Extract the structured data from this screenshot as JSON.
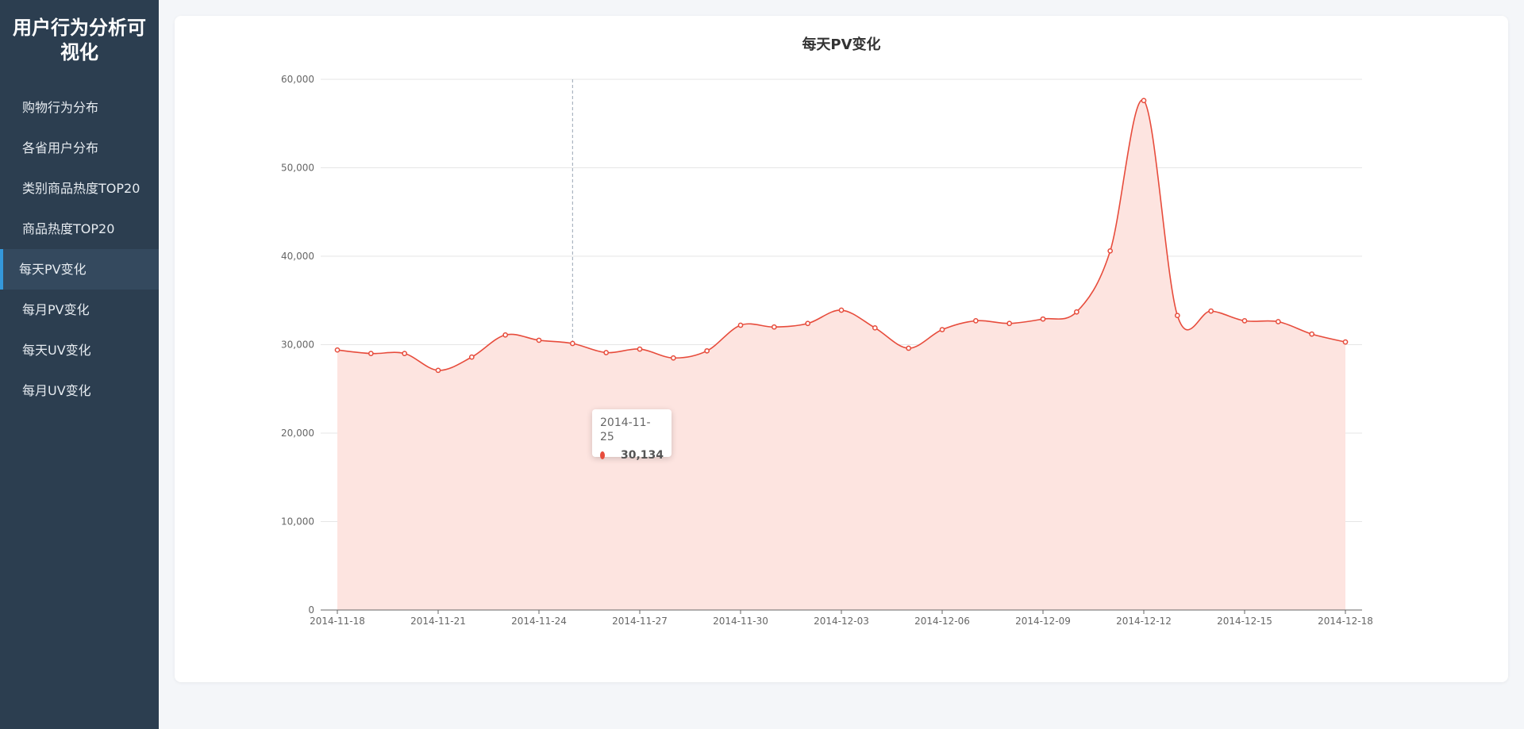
{
  "app": {
    "title": "用户行为分析可视化"
  },
  "sidebar": {
    "items": [
      {
        "label": "购物行为分布",
        "active": false
      },
      {
        "label": "各省用户分布",
        "active": false
      },
      {
        "label": "类别商品热度TOP20",
        "active": false
      },
      {
        "label": "商品热度TOP20",
        "active": false
      },
      {
        "label": "每天PV变化",
        "active": true
      },
      {
        "label": "每月PV变化",
        "active": false
      },
      {
        "label": "每天UV变化",
        "active": false
      },
      {
        "label": "每月UV变化",
        "active": false
      }
    ]
  },
  "colors": {
    "accent": "#e74c3c",
    "area": "#fde4e0",
    "sidebar": "#2c3e50",
    "sidebar_active": "#34495e",
    "active_marker": "#3498db"
  },
  "tooltip": {
    "date": "2014-11-25",
    "value": "30,134"
  },
  "chart_data": {
    "type": "area",
    "title": "每天PV变化",
    "x": [
      "2014-11-18",
      "2014-11-19",
      "2014-11-20",
      "2014-11-21",
      "2014-11-22",
      "2014-11-23",
      "2014-11-24",
      "2014-11-25",
      "2014-11-26",
      "2014-11-27",
      "2014-11-28",
      "2014-11-29",
      "2014-11-30",
      "2014-12-01",
      "2014-12-02",
      "2014-12-03",
      "2014-12-04",
      "2014-12-05",
      "2014-12-06",
      "2014-12-07",
      "2014-12-08",
      "2014-12-09",
      "2014-12-10",
      "2014-12-11",
      "2014-12-12",
      "2014-12-13",
      "2014-12-14",
      "2014-12-15",
      "2014-12-16",
      "2014-12-17",
      "2014-12-18"
    ],
    "series": [
      {
        "values": [
          29400,
          29000,
          29000,
          27100,
          28600,
          31100,
          30500,
          30134,
          29100,
          29500,
          28500,
          29300,
          32200,
          32000,
          32400,
          33900,
          31900,
          29600,
          31700,
          32700,
          32400,
          32900,
          33700,
          40600,
          57600,
          33300,
          33800,
          32700,
          32600,
          31200,
          30300
        ]
      }
    ],
    "xticks": [
      "2014-11-18",
      "2014-11-21",
      "2014-11-24",
      "2014-11-27",
      "2014-11-30",
      "2014-12-03",
      "2014-12-06",
      "2014-12-09",
      "2014-12-12",
      "2014-12-15",
      "2014-12-18"
    ],
    "yticks": [
      "0",
      "10,000",
      "20,000",
      "30,000",
      "40,000",
      "50,000",
      "60,000"
    ],
    "ylim": [
      0,
      60000
    ],
    "grid": true,
    "smooth": true,
    "highlight": "2014-11-25"
  }
}
